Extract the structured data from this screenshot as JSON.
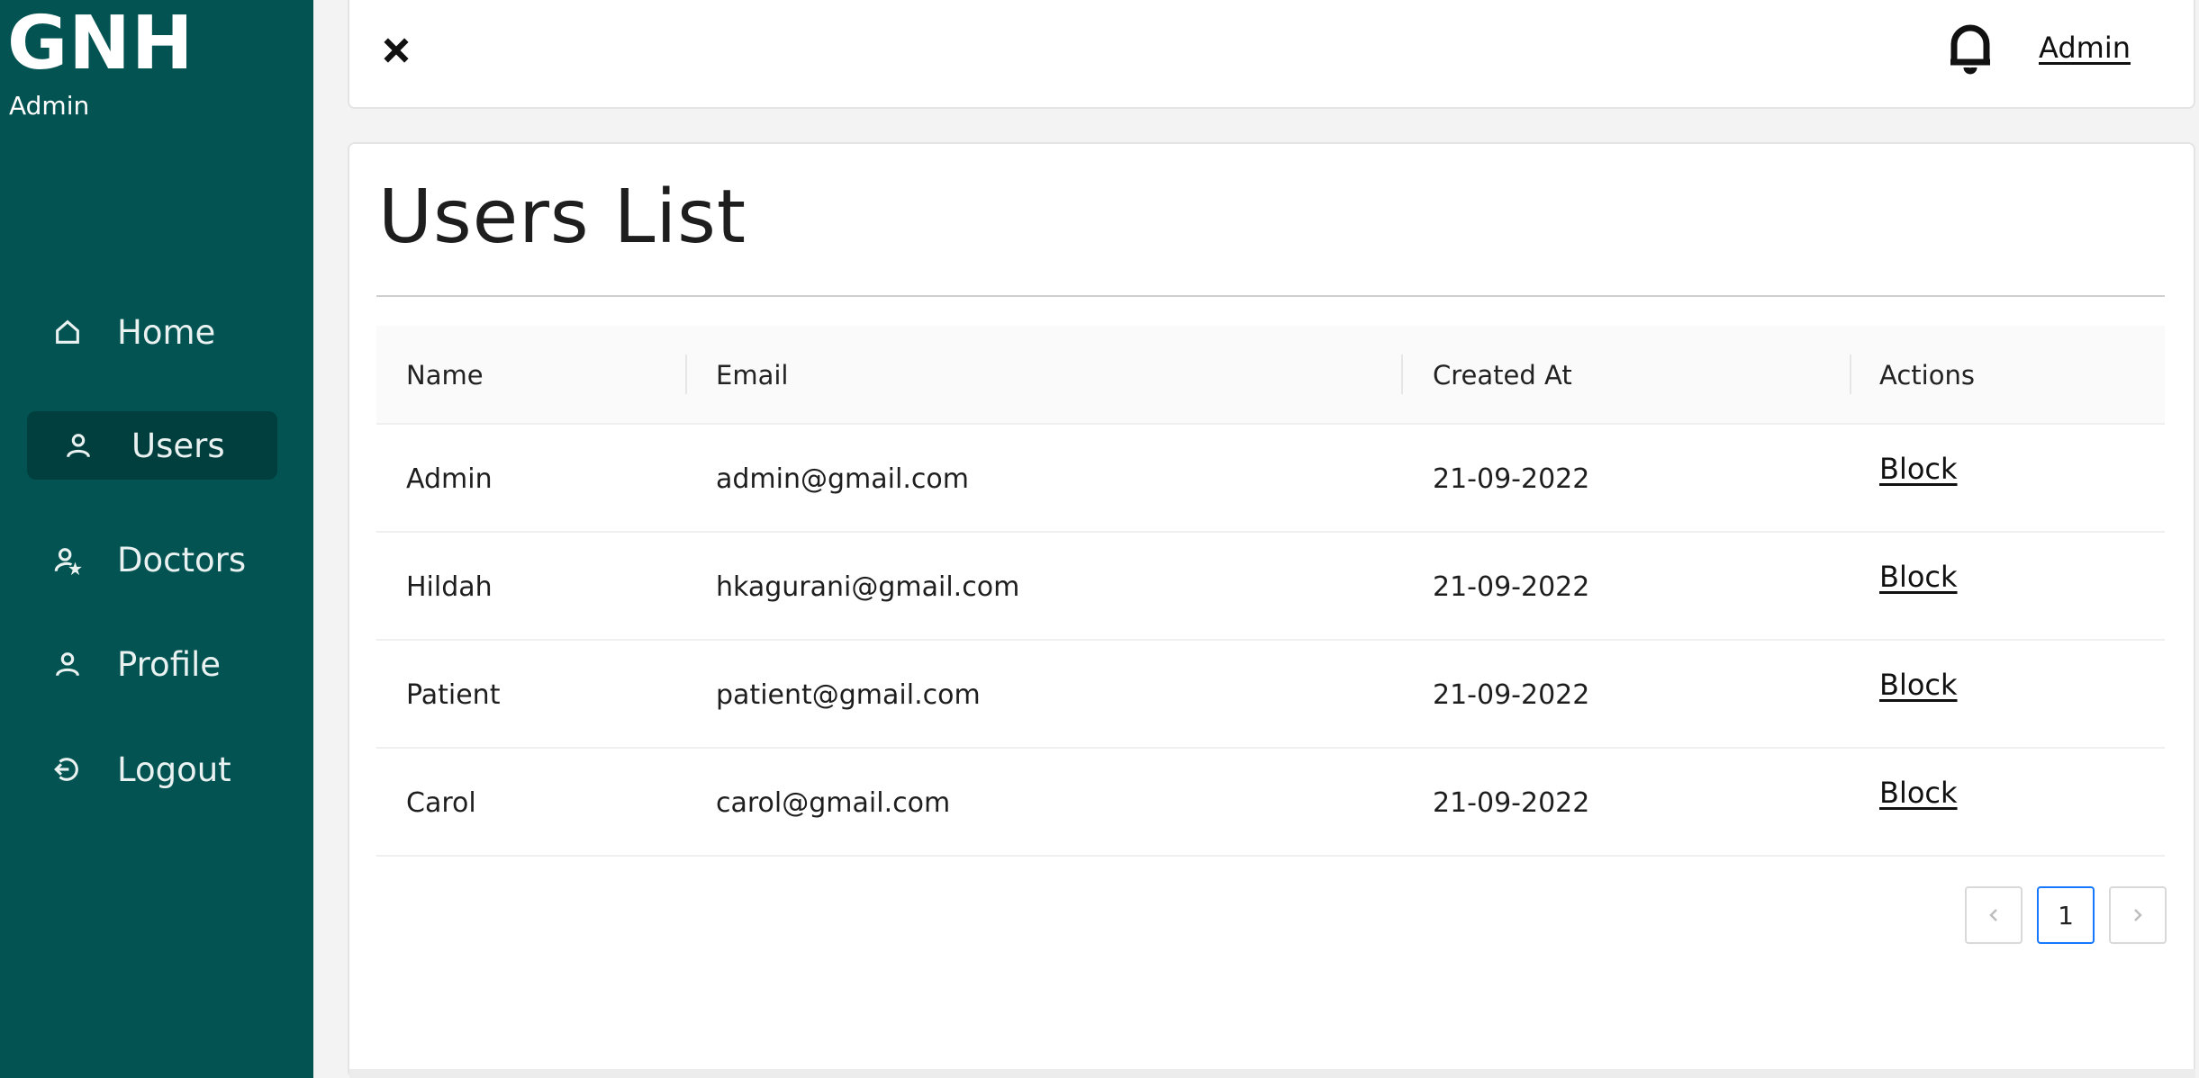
{
  "sidebar": {
    "brand_title": "GNH",
    "brand_subtitle": "Admin",
    "items": [
      {
        "label": "Home",
        "icon": "home-icon",
        "active": false
      },
      {
        "label": "Users",
        "icon": "user-icon",
        "active": true
      },
      {
        "label": "Doctors",
        "icon": "doctor-icon",
        "active": false
      },
      {
        "label": "Profile",
        "icon": "profile-icon",
        "active": false
      },
      {
        "label": "Logout",
        "icon": "logout-icon",
        "active": false
      }
    ],
    "background_color": "#035352",
    "active_color": "#013f3e"
  },
  "topbar": {
    "close_icon": "close-icon",
    "notification_icon": "bell-icon",
    "user_link": "Admin"
  },
  "main": {
    "title": "Users List",
    "table": {
      "columns": [
        "Name",
        "Email",
        "Created At",
        "Actions"
      ],
      "rows": [
        {
          "name": "Admin",
          "email": "admin@gmail.com",
          "created_at": "21-09-2022",
          "action": "Block"
        },
        {
          "name": "Hildah",
          "email": "hkagurani@gmail.com",
          "created_at": "21-09-2022",
          "action": "Block"
        },
        {
          "name": "Patient",
          "email": "patient@gmail.com",
          "created_at": "21-09-2022",
          "action": "Block"
        },
        {
          "name": "Carol",
          "email": "carol@gmail.com",
          "created_at": "21-09-2022",
          "action": "Block"
        }
      ]
    },
    "pagination": {
      "current_page": "1",
      "prev_icon": "chevron-left-icon",
      "next_icon": "chevron-right-icon",
      "accent_color": "#1677ff"
    }
  }
}
